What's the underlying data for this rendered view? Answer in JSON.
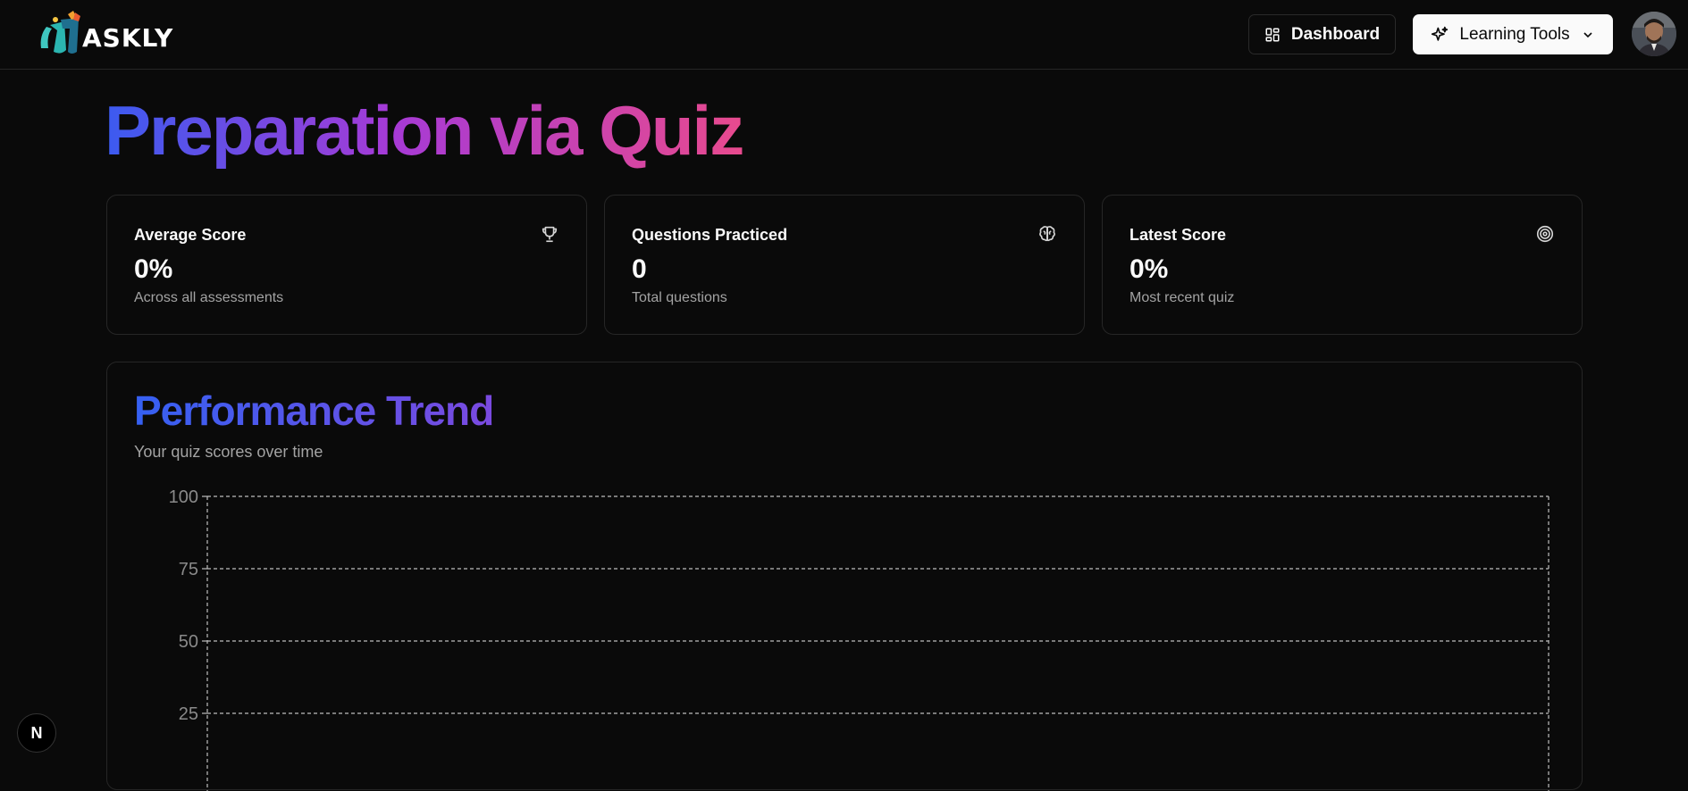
{
  "header": {
    "logo_text": "ASKLY",
    "dashboard_label": "Dashboard",
    "tools_label": "Learning Tools"
  },
  "page": {
    "title": "Preparation via Quiz"
  },
  "stats": [
    {
      "title": "Average Score",
      "value": "0%",
      "desc": "Across all assessments",
      "icon": "trophy-icon"
    },
    {
      "title": "Questions Practiced",
      "value": "0",
      "desc": "Total questions",
      "icon": "brain-icon"
    },
    {
      "title": "Latest Score",
      "value": "0%",
      "desc": "Most recent quiz",
      "icon": "target-icon"
    }
  ],
  "trend": {
    "title": "Performance Trend",
    "subtitle": "Your quiz scores over time"
  },
  "chart_data": {
    "type": "line",
    "title": "Performance Trend",
    "subtitle": "Your quiz scores over time",
    "x": [],
    "series": [],
    "yticks": [
      100,
      75,
      50,
      25
    ],
    "ylim": [
      0,
      100
    ],
    "grid": true
  },
  "dev_badge": {
    "letter": "N"
  },
  "colors": {
    "background": "#0a0a0a",
    "border": "#262626",
    "title_gradient": [
      "#3b5bf0",
      "#a63ad6",
      "#e84a8e"
    ],
    "trend_gradient": [
      "#3560f2",
      "#7a4ae0"
    ],
    "muted_text": "#a3a3a3",
    "grid": "#bdbdbd"
  }
}
